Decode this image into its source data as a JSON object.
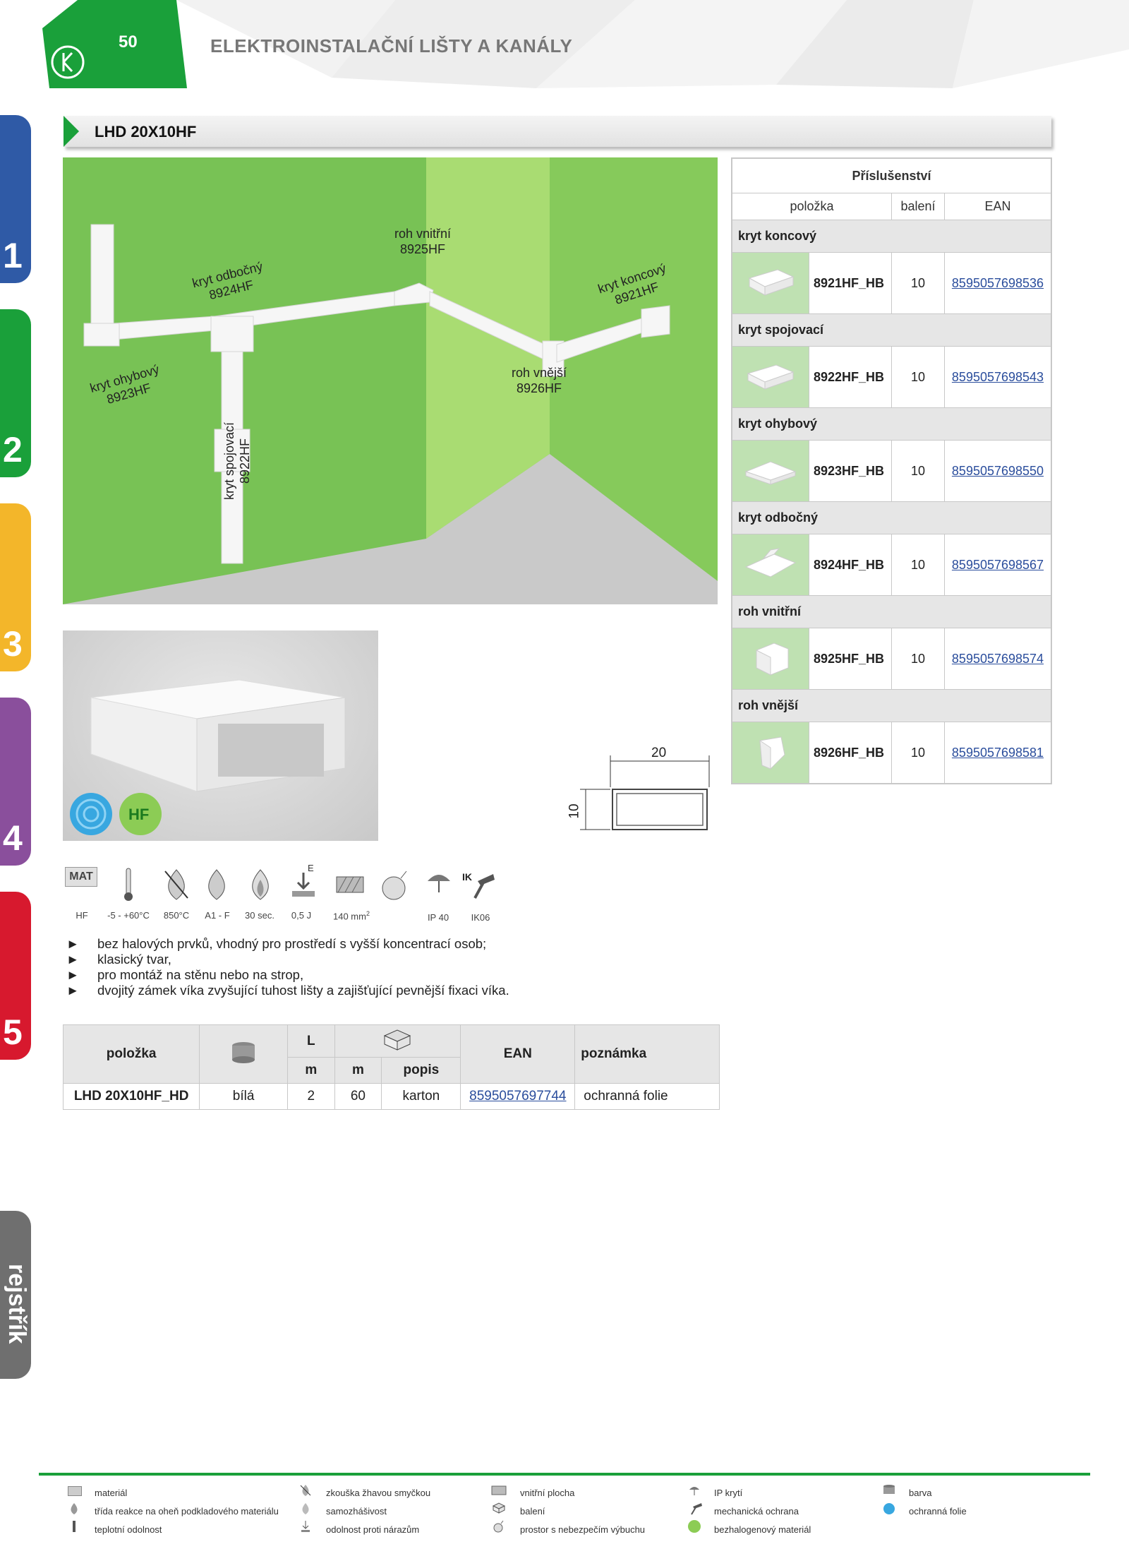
{
  "header": {
    "page_number": "50",
    "title": "ELEKTROINSTALAČNÍ LIŠTY A KANÁLY"
  },
  "side_tabs": [
    "1",
    "2",
    "3",
    "4",
    "5",
    "rejstřík"
  ],
  "product": {
    "title": "LHD 20X10HF"
  },
  "scene_labels": {
    "kryt_odbocny": [
      "kryt odbočný",
      "8924HF"
    ],
    "roh_vnitrni": [
      "roh vnitřní",
      "8925HF"
    ],
    "kryt_koncovy": [
      "kryt koncový",
      "8921HF"
    ],
    "kryt_ohybovy": [
      "kryt ohybový",
      "8923HF"
    ],
    "roh_vnejsi": [
      "roh vnější",
      "8926HF"
    ],
    "kryt_spojovaci": [
      "kryt spojovací",
      "8922HF"
    ]
  },
  "photo_badge": "HF",
  "dimensions": {
    "width": "20",
    "height": "10"
  },
  "accessories": {
    "title": "Příslušenství",
    "columns": [
      "položka",
      "balení",
      "EAN"
    ],
    "sections": [
      {
        "name": "kryt koncový",
        "code": "8921HF_HB",
        "qty": "10",
        "ean": "8595057698536"
      },
      {
        "name": "kryt spojovací",
        "code": "8922HF_HB",
        "qty": "10",
        "ean": "8595057698543"
      },
      {
        "name": "kryt ohybový",
        "code": "8923HF_HB",
        "qty": "10",
        "ean": "8595057698550"
      },
      {
        "name": "kryt odbočný",
        "code": "8924HF_HB",
        "qty": "10",
        "ean": "8595057698567"
      },
      {
        "name": "roh vnitřní",
        "code": "8925HF_HB",
        "qty": "10",
        "ean": "8595057698574"
      },
      {
        "name": "roh vnější",
        "code": "8926HF_HB",
        "qty": "10",
        "ean": "8595057698581"
      }
    ]
  },
  "icons": {
    "mat_label": "MAT",
    "e_label": "E",
    "ik_label": "IK",
    "values": [
      "HF",
      "-5 - +60°C",
      "850°C",
      "A1 - F",
      "30 sec.",
      "0,5 J",
      "140 mm",
      "IP 40",
      "IK06"
    ],
    "area_sup": "2"
  },
  "bullets": [
    "bez halových prvků, vhodný pro prostředí s vyšší koncentrací osob;",
    "klasický tvar,",
    "pro montáž na stěnu nebo na strop,",
    "dvojitý zámek víka zvyšující tuhost lišty a zajišťující pevnější fixaci víka."
  ],
  "bullet_marker": "►",
  "main_table": {
    "headers": {
      "polozka": "položka",
      "L": "L",
      "EAN": "EAN",
      "poznamka": "poznámka",
      "unit_m1": "m",
      "unit_m2": "m",
      "popis": "popis"
    },
    "rows": [
      {
        "polozka": "LHD 20X10HF_HD",
        "barva": "bílá",
        "L": "2",
        "m": "60",
        "popis": "karton",
        "ean": "8595057697744",
        "poznamka": "ochranná folie"
      }
    ]
  },
  "legend": [
    [
      "materiál",
      "třída reakce na oheň podkladového materiálu",
      "teplotní odolnost"
    ],
    [
      "zkouška žhavou smyčkou",
      "samozhášivost",
      "odolnost proti nárazům"
    ],
    [
      "vnitřní plocha",
      "balení",
      "prostor s nebezpečím výbuchu"
    ],
    [
      "IP krytí",
      "mechanická ochrana",
      "bezhalogenový materiál"
    ],
    [
      "barva",
      "ochranná folie"
    ]
  ],
  "colors": {
    "green": "#1aa03a",
    "tab1": "#2f5aa6",
    "tab2": "#1aa03a",
    "tab3": "#f3b62a",
    "tab4": "#8a4f9c",
    "tab5": "#d7192e",
    "tab_rej": "#6f6f6f",
    "link": "#2a4d9c"
  }
}
